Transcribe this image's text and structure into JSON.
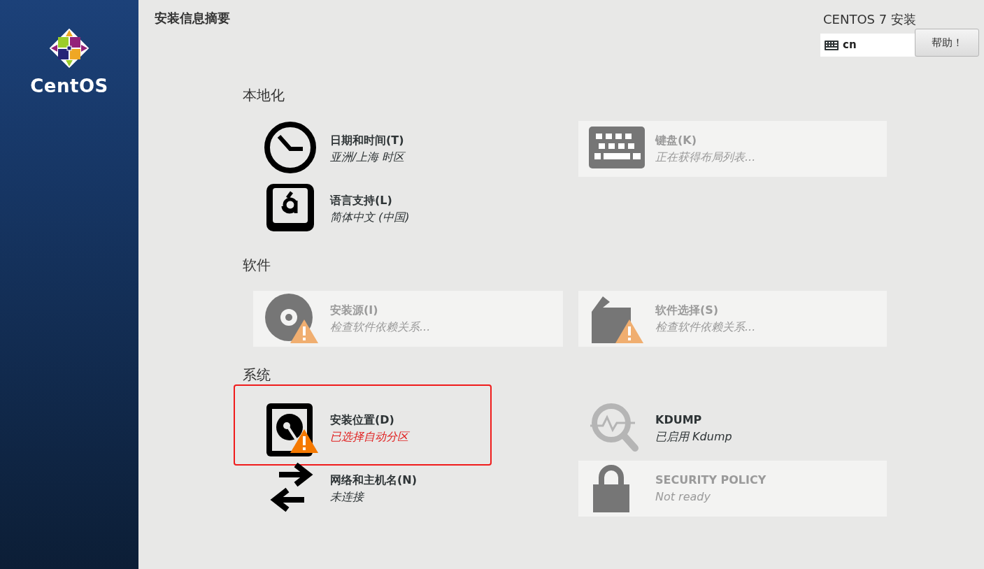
{
  "sidebar": {
    "logo_text": "CentOS"
  },
  "header": {
    "title": "安装信息摘要",
    "product": "CENTOS 7 安装",
    "keyboard_layout": "cn",
    "help_button": "帮助！"
  },
  "sections": [
    {
      "heading": "本地化",
      "rows": [
        [
          {
            "kind": "clock",
            "title": "日期和时间(T)",
            "status": "亚洲/上海 时区",
            "disabled": false,
            "warning": false,
            "error": false,
            "highlighted": false
          },
          {
            "kind": "keyboard",
            "title": "键盘(K)",
            "status": "正在获得布局列表...",
            "disabled": true,
            "warning": false,
            "error": false,
            "highlighted": false
          }
        ],
        [
          {
            "kind": "language",
            "title": "语言支持(L)",
            "status": "简体中文 (中国)",
            "disabled": false,
            "warning": false,
            "error": false,
            "highlighted": false
          }
        ]
      ]
    },
    {
      "heading": "软件",
      "rows": [
        [
          {
            "kind": "disc",
            "title": "安装源(I)",
            "status": "检查软件依赖关系...",
            "disabled": true,
            "warning": true,
            "error": false,
            "highlighted": false
          },
          {
            "kind": "package",
            "title": "软件选择(S)",
            "status": "检查软件依赖关系...",
            "disabled": true,
            "warning": true,
            "error": false,
            "highlighted": false
          }
        ]
      ]
    },
    {
      "heading": "系统",
      "rows": [
        [
          {
            "kind": "harddisk",
            "title": "安装位置(D)",
            "status": "已选择自动分区",
            "disabled": false,
            "warning": true,
            "error": true,
            "highlighted": true
          },
          {
            "kind": "magnifier",
            "title": "KDUMP",
            "status": "已启用 Kdump",
            "disabled": false,
            "warning": false,
            "error": false,
            "highlighted": false
          }
        ],
        [
          {
            "kind": "arrows",
            "title": "网络和主机名(N)",
            "status": "未连接",
            "disabled": false,
            "warning": false,
            "error": false,
            "highlighted": false
          },
          {
            "kind": "lock",
            "title": "SECURITY POLICY",
            "status": "Not ready",
            "disabled": true,
            "warning": false,
            "error": false,
            "highlighted": false
          }
        ]
      ]
    }
  ]
}
